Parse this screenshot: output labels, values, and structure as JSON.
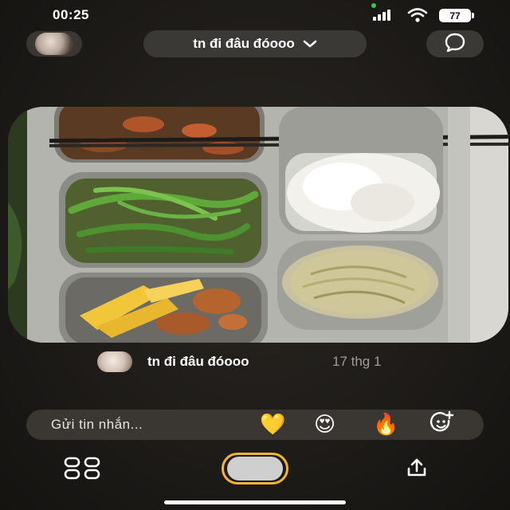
{
  "status_bar": {
    "time": "00:25",
    "battery": "77"
  },
  "header": {
    "title": "tn đi đâu đóooo",
    "avatar_icon": "profile-avatar",
    "chevron_icon": "chevron-down-icon",
    "chat_icon": "chat-bubble-icon"
  },
  "post": {
    "photo": "tray-of-food",
    "author": "tn đi đâu đóooo",
    "date": "17 thg 1"
  },
  "message_bar": {
    "placeholder": "Gửi tin nhắn...",
    "reactions": [
      "💛",
      "😍",
      "🔥"
    ],
    "add_reaction_icon": "smiley-plus-icon"
  },
  "bottom_bar": {
    "grid_icon": "grid-icon",
    "shutter_icon": "capture-button",
    "share_icon": "share-upload-icon",
    "accent_color": "#f3b23a"
  }
}
